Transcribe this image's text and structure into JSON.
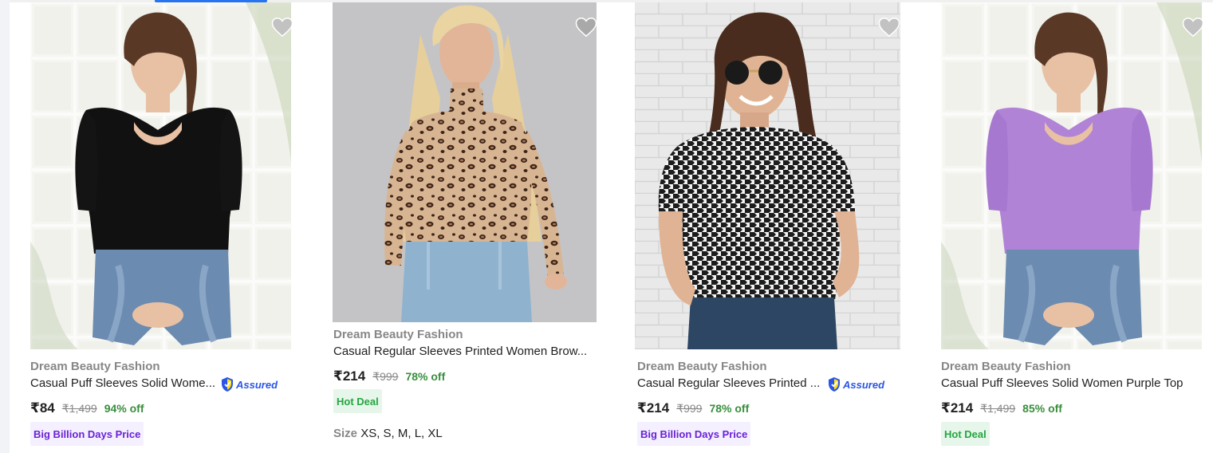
{
  "theme": {
    "accent": "#2874f0",
    "discount_green": "#388e3c",
    "hot_deal_bg": "#e6f6ea",
    "hot_deal_text": "#26a541",
    "bbd_bg": "#f4f0ff",
    "bbd_text": "#6a22d6",
    "assured_blue": "#2a55e5"
  },
  "products": [
    {
      "brand": "Dream Beauty Fashion",
      "title": "Casual Puff Sleeves Solid Women Black Top",
      "title_display": "Casual Puff Sleeves Solid Wome...",
      "assured": "Assured",
      "price": "₹84",
      "mrp": "₹1,499",
      "discount": "94% off",
      "badge": "Big Billion Days Price",
      "image_icon": "product-image-black-top",
      "wishlist_icon": "heart-icon"
    },
    {
      "brand": "Dream Beauty Fashion",
      "title": "Casual Regular Sleeves Printed Women Brow...",
      "price": "₹214",
      "mrp": "₹999",
      "discount": "78% off",
      "badge": "Hot Deal",
      "size_label": "Size",
      "sizes": "XS, S, M, L, XL",
      "image_icon": "product-image-leopard-top",
      "wishlist_icon": "heart-icon"
    },
    {
      "brand": "Dream Beauty Fashion",
      "title": "Casual Regular Sleeves Printed ...",
      "assured": "Assured",
      "price": "₹214",
      "mrp": "₹999",
      "discount": "78% off",
      "badge": "Big Billion Days Price",
      "image_icon": "product-image-houndstooth-top",
      "wishlist_icon": "heart-icon"
    },
    {
      "brand": "Dream Beauty Fashion",
      "title": "Casual Puff Sleeves Solid Women Purple Top",
      "price": "₹214",
      "mrp": "₹1,499",
      "discount": "85% off",
      "badge": "Hot Deal",
      "image_icon": "product-image-purple-top",
      "wishlist_icon": "heart-icon"
    }
  ]
}
